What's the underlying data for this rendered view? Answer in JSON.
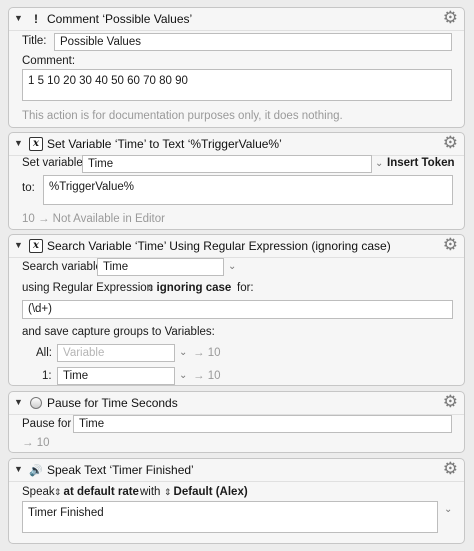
{
  "comment": {
    "header": "Comment ‘Possible Values’",
    "title_label": "Title:",
    "title_value": "Possible Values",
    "comment_label": "Comment:",
    "comment_value": "1 5 10 20 30 40 50 60 70 80 90",
    "note": "This action is for documentation purposes only, it does nothing."
  },
  "set_variable": {
    "header": "Set Variable ‘Time’ to Text ‘%TriggerValue%’",
    "set_label": "Set variable",
    "var_value": "Time",
    "insert_token": "Insert Token",
    "to_label": "to:",
    "to_value": "%TriggerValue%",
    "footer": "10 → Not Available in Editor"
  },
  "search_variable": {
    "header": "Search Variable ‘Time’ Using Regular Expression (ignoring case)",
    "search_label": "Search variable",
    "var_value": "Time",
    "using_label": "using Regular Expression",
    "case_option": "ignoring case",
    "for_label": "for:",
    "regex_value": "(\\d+)",
    "save_label": "and save capture groups to Variables:",
    "all_label": "All:",
    "all_placeholder": "Variable",
    "all_result": "→ 10",
    "one_label": "1:",
    "one_value": "Time",
    "one_result": "→ 10"
  },
  "pause": {
    "header": "Pause for Time Seconds",
    "pause_label": "Pause for",
    "pause_value": "Time",
    "result": "→ 10"
  },
  "speak": {
    "header": "Speak Text ‘Timer Finished’",
    "speak_label": "Speak",
    "rate": "at default rate",
    "with_label": "with",
    "voice": "Default (Alex)",
    "text_value": "Timer Finished"
  },
  "icons": {
    "disclosure": "disclosure-triangle-icon",
    "gear": "gear-icon",
    "comment": "exclamation-icon",
    "variable": "variable-x-icon",
    "pause": "pause-icon",
    "speaker": "speaker-icon"
  }
}
